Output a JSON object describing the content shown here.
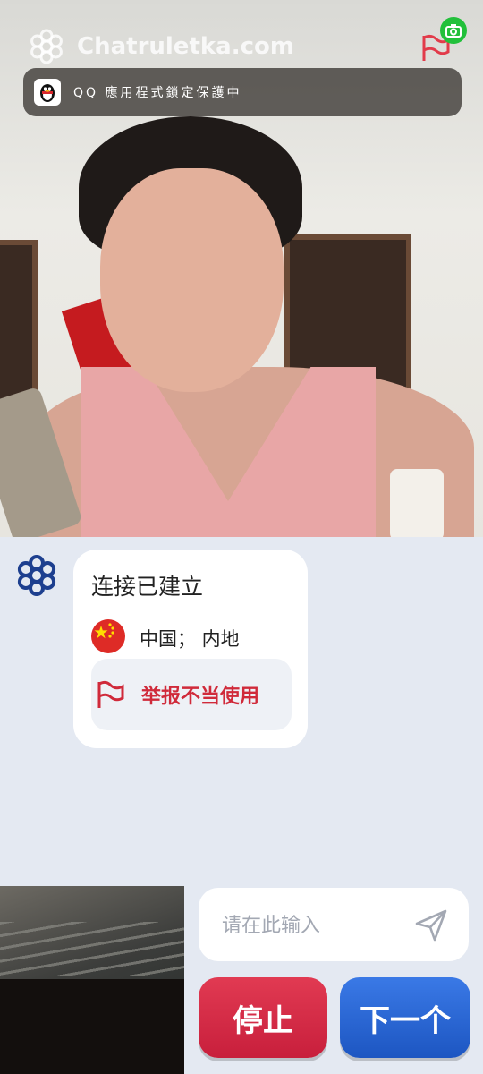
{
  "app": {
    "site_name": "Chatruletka.com"
  },
  "notification": {
    "text": "QQ 應用程式鎖定保護中",
    "app_icon": "qq-penguin-icon"
  },
  "chat": {
    "status": "连接已建立",
    "country": "中国； 内地",
    "country_flag": "china-flag-icon",
    "report_label": "举报不当使用"
  },
  "input": {
    "placeholder": "请在此输入",
    "value": ""
  },
  "buttons": {
    "stop_label": "停止",
    "next_label": "下一个"
  },
  "colors": {
    "stop": "#d42a44",
    "next": "#2a66d6",
    "report": "#d02a3a",
    "brand": "#1d3f8f",
    "camera": "#22c03b"
  }
}
